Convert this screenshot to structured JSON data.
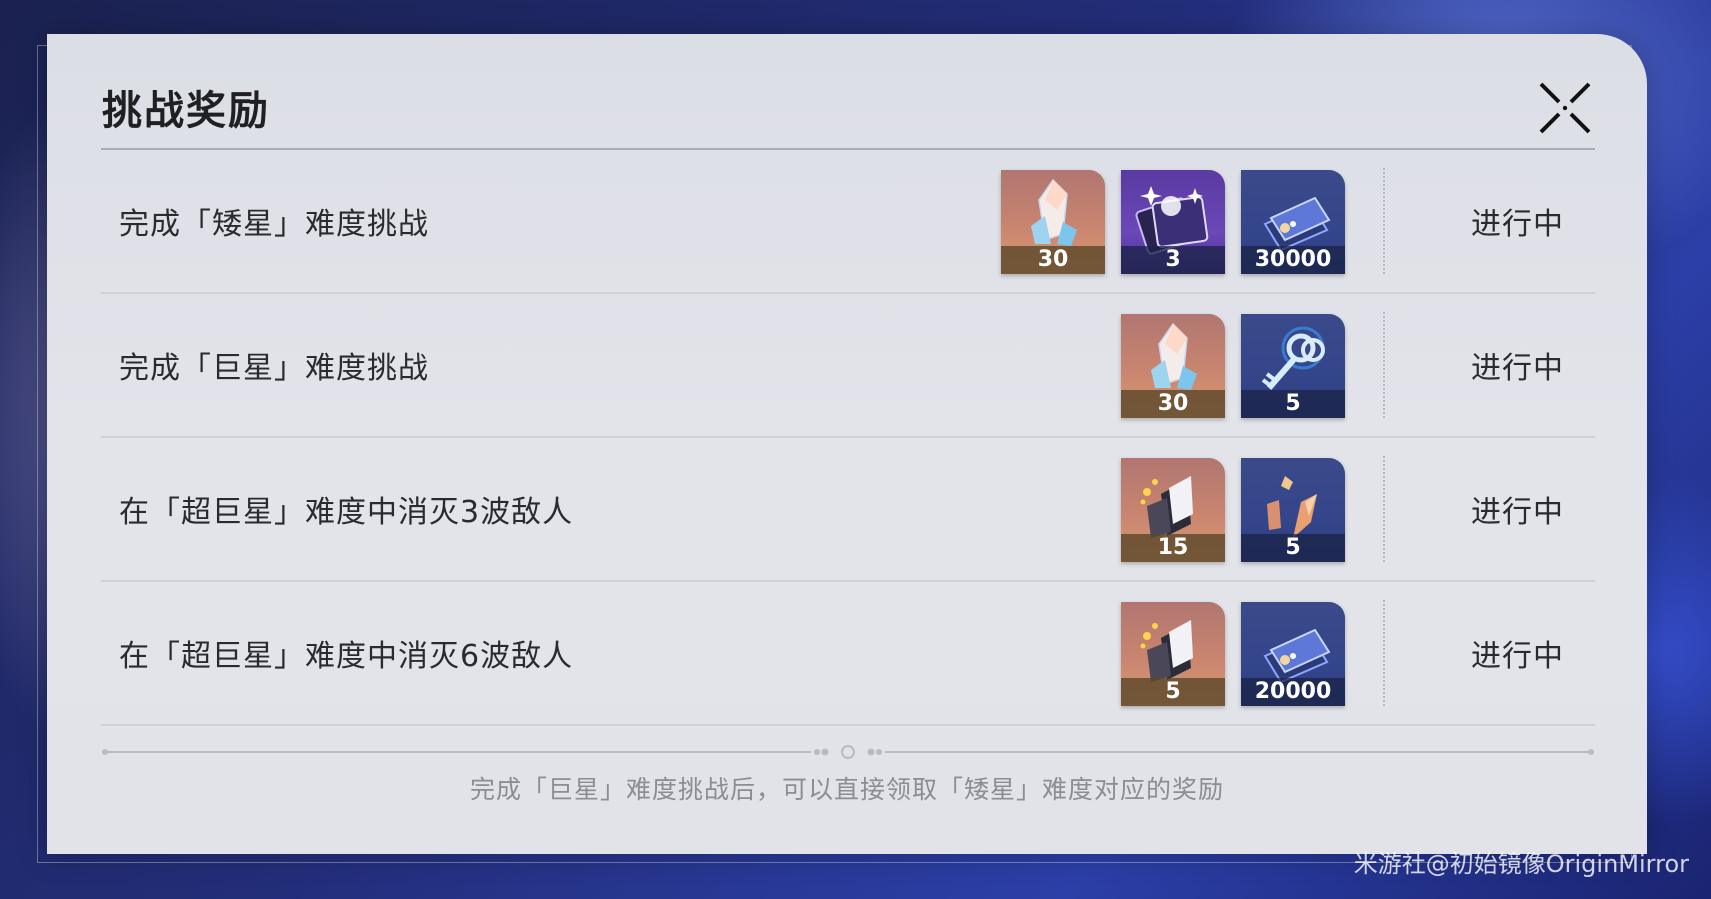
{
  "dialog": {
    "title": "挑战奖励",
    "footnote": "完成「巨星」难度挑战后，可以直接领取「矮星」难度对应的奖励"
  },
  "rows": [
    {
      "text": "完成「矮星」难度挑战",
      "status": "进行中",
      "rewards": [
        {
          "icon": "crystal-icon",
          "quantity": "30"
        },
        {
          "icon": "special-pass-icon",
          "quantity": "3"
        },
        {
          "icon": "credit-ticket-icon",
          "quantity": "30000"
        }
      ]
    },
    {
      "text": "完成「巨星」难度挑战",
      "status": "进行中",
      "rewards": [
        {
          "icon": "crystal-icon",
          "quantity": "30"
        },
        {
          "icon": "key-icon",
          "quantity": "5"
        }
      ]
    },
    {
      "text": "在「超巨星」难度中消灭3波敌人",
      "status": "进行中",
      "rewards": [
        {
          "icon": "material-pack-icon",
          "quantity": "15"
        },
        {
          "icon": "ore-shard-icon",
          "quantity": "5"
        }
      ]
    },
    {
      "text": "在「超巨星」难度中消灭6波敌人",
      "status": "进行中",
      "rewards": [
        {
          "icon": "material-pack-icon",
          "quantity": "5"
        },
        {
          "icon": "credit-ticket-icon",
          "quantity": "20000"
        }
      ]
    }
  ],
  "watermark": "米游社@初始镜像OriginMirror"
}
